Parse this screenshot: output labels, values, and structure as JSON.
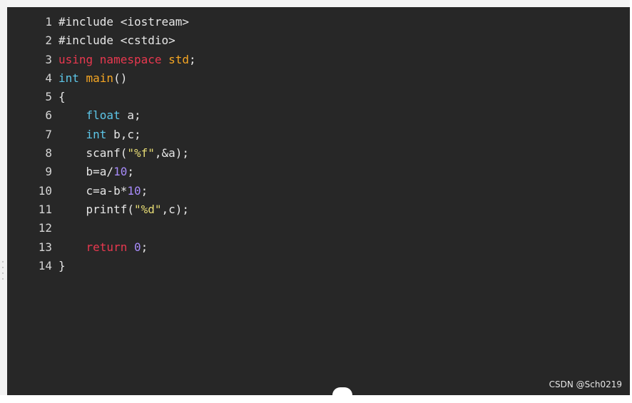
{
  "code": {
    "lines": [
      {
        "number": "1",
        "tokens": [
          {
            "text": "#include <iostream>",
            "type": "plain"
          }
        ]
      },
      {
        "number": "2",
        "tokens": [
          {
            "text": "#include <cstdio>",
            "type": "plain"
          }
        ]
      },
      {
        "number": "3",
        "tokens": [
          {
            "text": "using namespace ",
            "type": "kw"
          },
          {
            "text": "std",
            "type": "func"
          },
          {
            "text": ";",
            "type": "plain"
          }
        ]
      },
      {
        "number": "4",
        "tokens": [
          {
            "text": "int ",
            "type": "type"
          },
          {
            "text": "main",
            "type": "func"
          },
          {
            "text": "()",
            "type": "plain"
          }
        ]
      },
      {
        "number": "5",
        "tokens": [
          {
            "text": "{",
            "type": "plain"
          }
        ]
      },
      {
        "number": "6",
        "tokens": [
          {
            "text": "    ",
            "type": "plain"
          },
          {
            "text": "float ",
            "type": "type"
          },
          {
            "text": "a;",
            "type": "plain"
          }
        ]
      },
      {
        "number": "7",
        "tokens": [
          {
            "text": "    ",
            "type": "plain"
          },
          {
            "text": "int ",
            "type": "type"
          },
          {
            "text": "b,c;",
            "type": "plain"
          }
        ]
      },
      {
        "number": "8",
        "tokens": [
          {
            "text": "    scanf(",
            "type": "plain"
          },
          {
            "text": "\"%f\"",
            "type": "str"
          },
          {
            "text": ",&a);",
            "type": "plain"
          }
        ]
      },
      {
        "number": "9",
        "tokens": [
          {
            "text": "    b=a/",
            "type": "plain"
          },
          {
            "text": "10",
            "type": "num"
          },
          {
            "text": ";",
            "type": "plain"
          }
        ]
      },
      {
        "number": "10",
        "tokens": [
          {
            "text": "    c=a-b*",
            "type": "plain"
          },
          {
            "text": "10",
            "type": "num"
          },
          {
            "text": ";",
            "type": "plain"
          }
        ]
      },
      {
        "number": "11",
        "tokens": [
          {
            "text": "    printf(",
            "type": "plain"
          },
          {
            "text": "\"%d\"",
            "type": "str"
          },
          {
            "text": ",c);",
            "type": "plain"
          }
        ]
      },
      {
        "number": "12",
        "tokens": []
      },
      {
        "number": "13",
        "tokens": [
          {
            "text": "    ",
            "type": "plain"
          },
          {
            "text": "return ",
            "type": "kw"
          },
          {
            "text": "0",
            "type": "num"
          },
          {
            "text": ";",
            "type": "plain"
          }
        ]
      },
      {
        "number": "14",
        "tokens": [
          {
            "text": "}",
            "type": "plain"
          }
        ]
      }
    ]
  },
  "watermark": {
    "text": "CSDN @Sch0219"
  },
  "colors": {
    "background": "#272727",
    "keyword": "#e8384f",
    "type": "#5dc6e8",
    "function": "#f5a623",
    "string": "#e6db74",
    "number": "#a78bfa",
    "text": "#e6e6e6"
  }
}
